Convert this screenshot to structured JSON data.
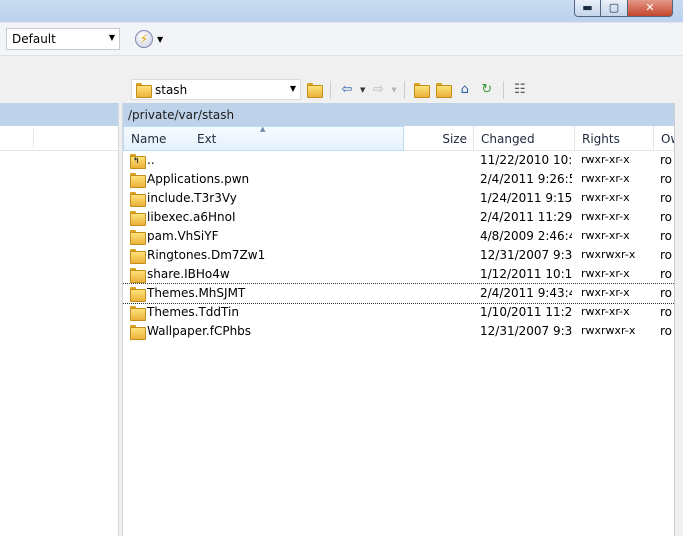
{
  "window": {
    "controls": {
      "minimize": "▬",
      "maximize": "▢",
      "close": "✕"
    }
  },
  "toolbar": {
    "profile": "Default",
    "flash_icon": "lightning-icon"
  },
  "remote": {
    "current_dir": "stash",
    "path": "/private/var/stash",
    "columns": {
      "name": "Name",
      "ext": "Ext",
      "size": "Size",
      "changed": "Changed",
      "rights": "Rights",
      "owner": "Ow"
    },
    "files": [
      {
        "name": "..",
        "changed": "11/22/2010 10:...",
        "rights": "rwxr-xr-x",
        "owner": "ro",
        "icon": "parent-folder-icon"
      },
      {
        "name": "Applications.pwn",
        "changed": "2/4/2011 9:26:5...",
        "rights": "rwxr-xr-x",
        "owner": "ro",
        "icon": "folder-icon"
      },
      {
        "name": "include.T3r3Vy",
        "changed": "1/24/2011 9:15:...",
        "rights": "rwxr-xr-x",
        "owner": "ro",
        "icon": "folder-icon"
      },
      {
        "name": "libexec.a6HnoI",
        "changed": "2/4/2011 11:29:...",
        "rights": "rwxr-xr-x",
        "owner": "ro",
        "icon": "folder-icon"
      },
      {
        "name": "pam.VhSiYF",
        "changed": "4/8/2009 2:46:4...",
        "rights": "rwxr-xr-x",
        "owner": "ro",
        "icon": "folder-icon"
      },
      {
        "name": "Ringtones.Dm7Zw1",
        "changed": "12/31/2007 9:3...",
        "rights": "rwxrwxr-x",
        "owner": "ro",
        "icon": "folder-icon"
      },
      {
        "name": "share.IBHo4w",
        "changed": "1/12/2011 10:1...",
        "rights": "rwxr-xr-x",
        "owner": "ro",
        "icon": "folder-icon"
      },
      {
        "name": "Themes.MhSJMT",
        "changed": "2/4/2011 9:43:4...",
        "rights": "rwxr-xr-x",
        "owner": "ro",
        "icon": "folder-icon"
      },
      {
        "name": "Themes.TddTin",
        "changed": "1/10/2011 11:2...",
        "rights": "rwxr-xr-x",
        "owner": "ro",
        "icon": "folder-icon"
      },
      {
        "name": "Wallpaper.fCPhbs",
        "changed": "12/31/2007 9:3...",
        "rights": "rwxrwxr-x",
        "owner": "ro",
        "icon": "folder-icon"
      }
    ]
  }
}
